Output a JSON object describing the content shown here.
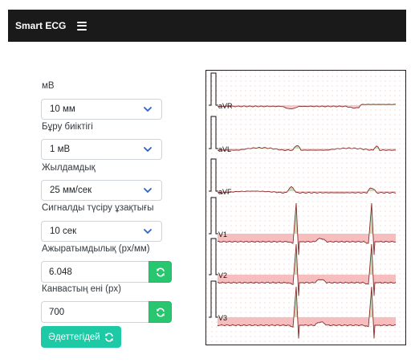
{
  "navbar": {
    "brand": "Smart ECG",
    "menu_icon": "hamburger-icon"
  },
  "controls": {
    "amplitude": {
      "label": "мВ",
      "value": "10 мм"
    },
    "deviation": {
      "label": "Бұру биіктігі",
      "value": "1 мВ"
    },
    "speed": {
      "label": "Жылдамдық",
      "value": "25 мм/сек"
    },
    "duration": {
      "label": "Сигналды түсіру ұзақтығы",
      "value": "10 сек"
    },
    "resolution": {
      "label": "Ажыратымдылық (px/мм)",
      "value": "6.048"
    },
    "canvas_width": {
      "label": "Канвастың ені (px)",
      "value": "700"
    },
    "reset_label": "Әдеттегідей"
  },
  "ecg": {
    "leads": [
      "aVR",
      "aVL",
      "aVF",
      "V1",
      "V2",
      "V3"
    ],
    "colors": {
      "grid_dot": "#f3a3a3",
      "trace": "#8b2a2a",
      "fill_neg": "#f4b3b3",
      "fill_pos": "#b9dcae",
      "calibration": "#111111"
    }
  }
}
